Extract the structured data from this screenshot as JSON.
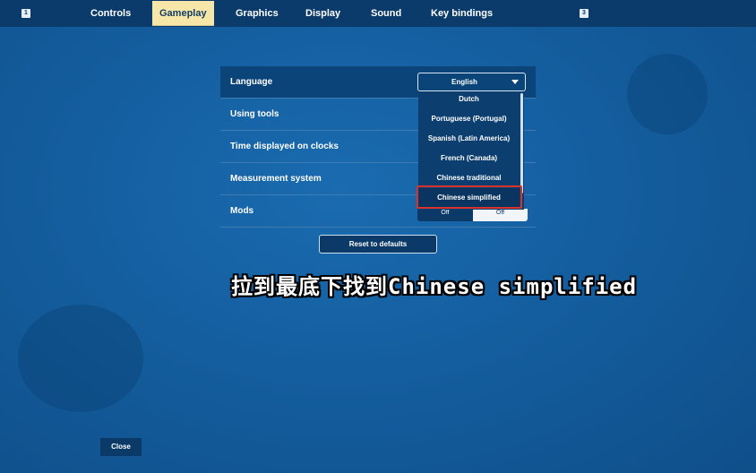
{
  "nav": {
    "left_key": "1",
    "right_key": "3",
    "tabs": [
      {
        "label": "Controls"
      },
      {
        "label": "Gameplay"
      },
      {
        "label": "Graphics"
      },
      {
        "label": "Display"
      },
      {
        "label": "Sound"
      },
      {
        "label": "Key bindings"
      }
    ],
    "active_tab": "Gameplay"
  },
  "settings": {
    "rows": [
      {
        "label": "Language"
      },
      {
        "label": "Using tools"
      },
      {
        "label": "Time displayed on clocks"
      },
      {
        "label": "Measurement system"
      },
      {
        "label": "Mods"
      }
    ],
    "language_select": {
      "value": "English"
    },
    "language_options": [
      "Dutch",
      "Portuguese (Portugal)",
      "Spanish (Latin America)",
      "French (Canada)",
      "Chinese traditional",
      "Chinese simplified"
    ],
    "selected_option": "Chinese simplified",
    "mods_toggle": {
      "left": "Off",
      "right": "Off"
    },
    "reset_label": "Reset to defaults"
  },
  "caption": "拉到最底下找到Chinese simplified",
  "close_label": "Close",
  "colors": {
    "background": "#145e9f",
    "topbar": "#0a3b6b",
    "active_tab": "#f6e7a8",
    "highlight_box": "#d9322b"
  }
}
